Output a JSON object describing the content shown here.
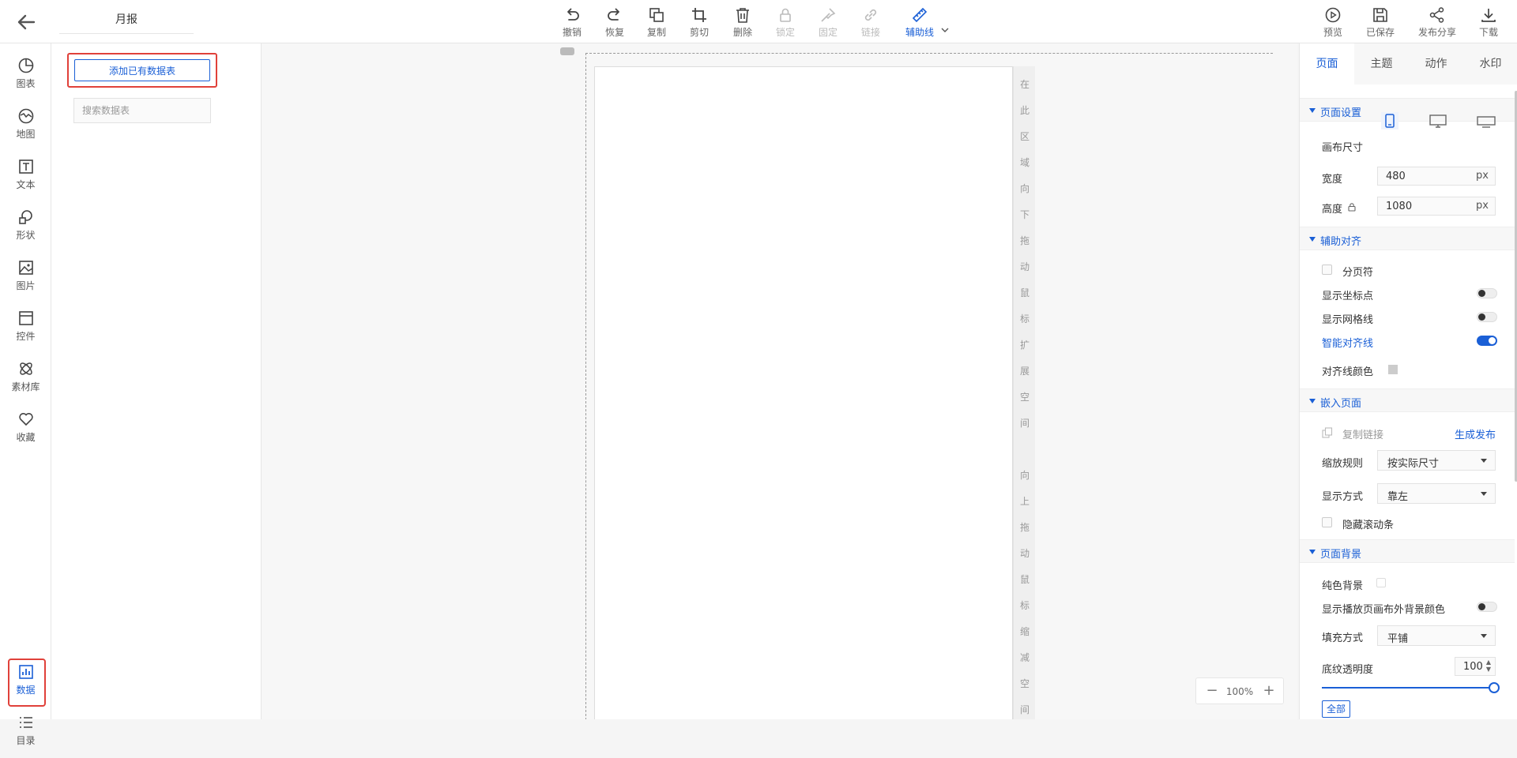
{
  "header": {
    "doc_title": "月报",
    "toolbar": [
      {
        "label": "撤销",
        "icon": "undo-icon",
        "state": "normal"
      },
      {
        "label": "恢复",
        "icon": "redo-icon",
        "state": "normal"
      },
      {
        "label": "复制",
        "icon": "copy-icon",
        "state": "normal"
      },
      {
        "label": "剪切",
        "icon": "crop-icon",
        "state": "normal"
      },
      {
        "label": "删除",
        "icon": "trash-icon",
        "state": "normal"
      },
      {
        "label": "锁定",
        "icon": "lock-icon",
        "state": "disabled"
      },
      {
        "label": "固定",
        "icon": "pin-icon",
        "state": "disabled"
      },
      {
        "label": "链接",
        "icon": "link-icon",
        "state": "disabled"
      },
      {
        "label": "辅助线",
        "icon": "ruler-icon",
        "state": "active"
      }
    ],
    "right_tools": [
      {
        "label": "预览",
        "icon": "play-icon"
      },
      {
        "label": "已保存",
        "icon": "save-icon"
      },
      {
        "label": "发布分享",
        "icon": "share-icon"
      },
      {
        "label": "下载",
        "icon": "download-icon"
      }
    ]
  },
  "leftnav": {
    "items": [
      {
        "label": "图表",
        "icon": "pie-chart-icon"
      },
      {
        "label": "地图",
        "icon": "map-icon"
      },
      {
        "label": "文本",
        "icon": "text-icon"
      },
      {
        "label": "形状",
        "icon": "shape-icon"
      },
      {
        "label": "图片",
        "icon": "image-icon"
      },
      {
        "label": "控件",
        "icon": "widget-icon"
      },
      {
        "label": "素材库",
        "icon": "material-icon"
      },
      {
        "label": "收藏",
        "icon": "heart-icon"
      }
    ],
    "bottom_items": [
      {
        "label": "数据",
        "icon": "bar-chart-icon",
        "active": true
      },
      {
        "label": "目录",
        "icon": "list-icon"
      }
    ]
  },
  "datapanel": {
    "add_label": "添加已有数据表",
    "search_placeholder": "搜索数据表"
  },
  "canvas": {
    "ext_top": [
      "在",
      "此",
      "区",
      "域",
      "向",
      "下",
      "拖",
      "动",
      "鼠",
      "标",
      "扩",
      "展",
      "空",
      "间"
    ],
    "ext_bottom": [
      "向",
      "上",
      "拖",
      "动",
      "鼠",
      "标",
      "缩",
      "减",
      "空",
      "间"
    ],
    "zoom_value": "100",
    "zoom_unit": "%",
    "zoom_minus": "−",
    "zoom_plus": "+"
  },
  "rpanel": {
    "tabs": [
      "页面",
      "主题",
      "动作",
      "水印"
    ],
    "active_tab": 0,
    "page_settings": {
      "title": "页面设置",
      "canvas_size_label": "画布尺寸",
      "width_label": "宽度",
      "width_value": "480",
      "height_label": "高度",
      "height_value": "1080",
      "unit": "px"
    },
    "align": {
      "title": "辅助对齐",
      "page_break": "分页符",
      "show_coords": "显示坐标点",
      "show_grid": "显示网格线",
      "smart_guides": "智能对齐线",
      "guide_color": "对齐线颜色",
      "guide_color_value": "#cccccc"
    },
    "embed": {
      "title": "嵌入页面",
      "copy_link": "复制链接",
      "generate": "生成发布",
      "scale_label": "缩放规则",
      "scale_value": "按实际尺寸",
      "display_label": "显示方式",
      "display_value": "靠左",
      "hide_scroll": "隐藏滚动条"
    },
    "background": {
      "title": "页面背景",
      "solid": "纯色背景",
      "show_outer": "显示播放页画布外背景颜色",
      "fill_label": "填充方式",
      "fill_value": "平铺",
      "opacity_label": "底纹透明度",
      "opacity_value": "100",
      "opacity_fraction": 1.0,
      "all_label": "全部"
    }
  },
  "colors": {
    "accent": "#1a5fd6",
    "highlight": "#e0413a"
  }
}
